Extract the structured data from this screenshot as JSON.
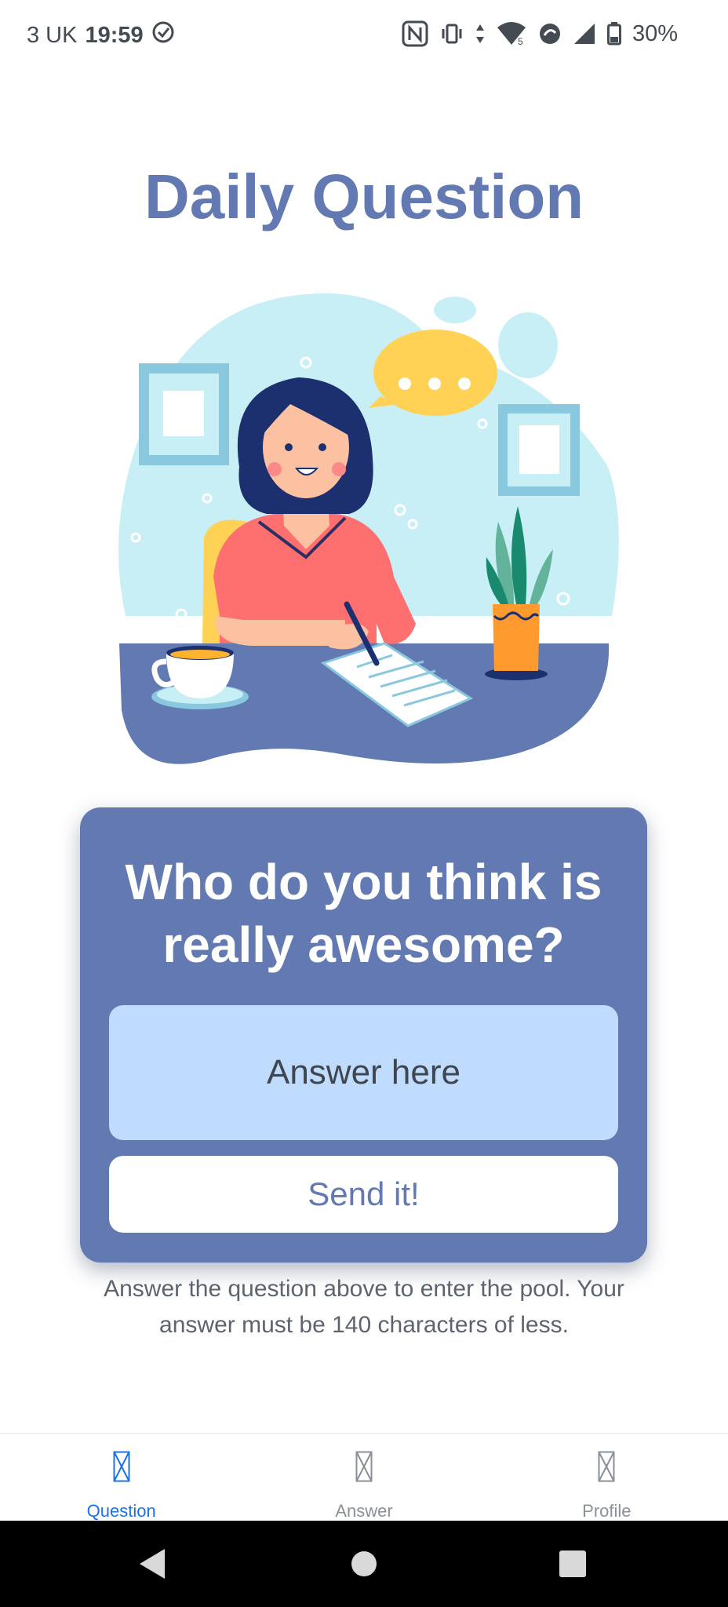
{
  "status_bar": {
    "carrier": "3 UK",
    "time": "19:59",
    "battery": "30%",
    "network_badge": "5"
  },
  "page": {
    "title": "Daily Question"
  },
  "question_card": {
    "question": "Who do you think is really awesome?",
    "answer_placeholder": "Answer here",
    "answer_value": "",
    "send_label": "Send it!"
  },
  "helper": {
    "text": "Answer the question above to enter the pool. Your answer must be 140 characters of less."
  },
  "bottom_nav": {
    "items": [
      {
        "label": "Question",
        "icon": "placeholder-box-icon",
        "active": true
      },
      {
        "label": "Answer",
        "icon": "placeholder-box-icon",
        "active": false
      },
      {
        "label": "Profile",
        "icon": "placeholder-box-icon",
        "active": false
      }
    ]
  },
  "system_nav": {
    "buttons": [
      "back-triangle-icon",
      "home-circle-icon",
      "recents-square-icon"
    ]
  },
  "colors": {
    "brand": "#6279b2",
    "answer_field": "#bfdbfe",
    "active_tab": "#1a73e8",
    "inactive_tab": "#8a9099"
  }
}
